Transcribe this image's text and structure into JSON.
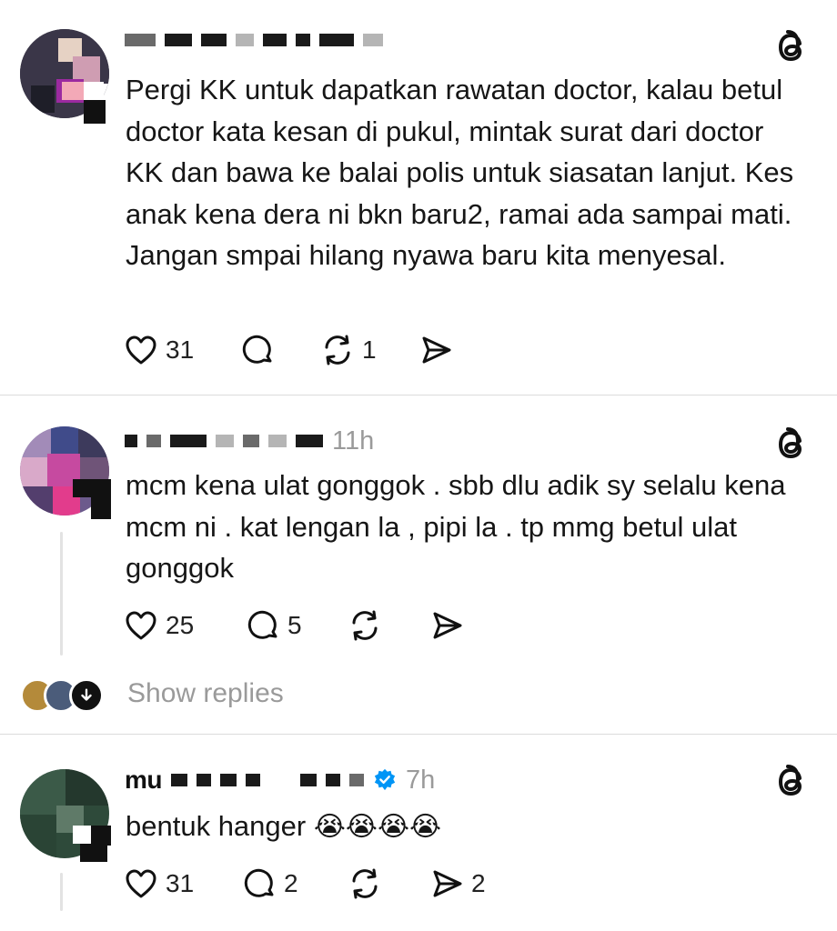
{
  "posts": [
    {
      "time": "",
      "text": "Pergi KK untuk dapatkan rawatan doctor, kalau betul doctor kata kesan di pukul, mintak surat dari doctor KK dan bawa ke balai polis untuk siasatan lanjut. Kes anak kena dera ni bkn baru2, ramai ada sampai mati. Jangan smpai hilang nyawa baru kita menyesal.",
      "likes": "31",
      "comments": "",
      "reposts": "1",
      "shares": ""
    },
    {
      "time": "11h",
      "text": "mcm kena ulat gonggok . sbb dlu adik sy selalu kena mcm ni . kat lengan la , pipi la . tp mmg betul ulat gonggok",
      "likes": "25",
      "comments": "5",
      "reposts": "",
      "shares": ""
    },
    {
      "handle_prefix": "mu",
      "time": "7h",
      "text": "bentuk hanger",
      "emojis": "😭😭😭😭",
      "likes": "31",
      "comments": "2",
      "reposts": "",
      "shares": "2"
    }
  ],
  "show_replies_label": "Show replies",
  "icons": {
    "app": "threads-logo-icon",
    "like": "heart-icon",
    "comment": "comment-bubble-icon",
    "repost": "repost-icon",
    "share": "send-icon",
    "reply_toggle": "arrow-down-icon",
    "verified": "verified-badge-icon"
  },
  "colors": {
    "text": "#161616",
    "muted": "#9a9a9a",
    "divider": "#dcdcdc",
    "verified": "#0095f6"
  }
}
